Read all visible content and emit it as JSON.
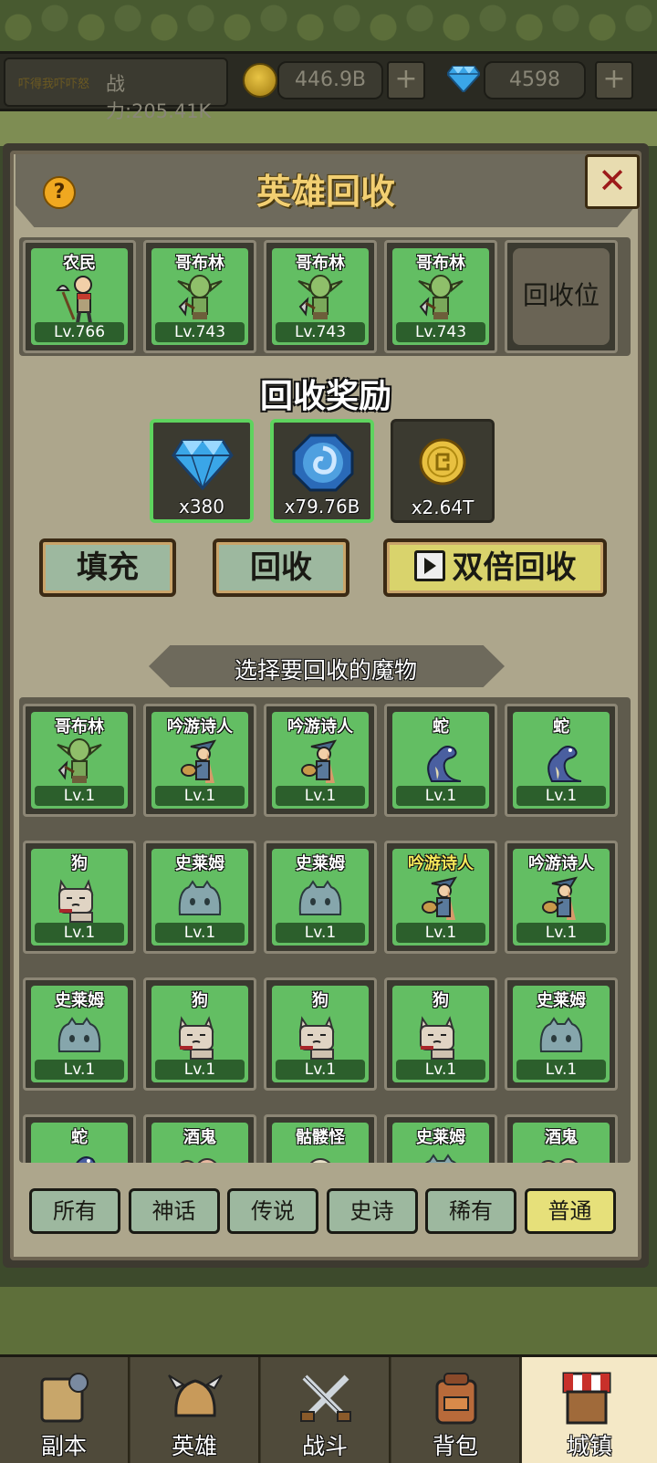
{
  "topbar": {
    "player_name": "吓得我吓吓怒",
    "power": "战力:205.41K",
    "gold": "446.9B",
    "gems": "4598",
    "plus": "+"
  },
  "panel": {
    "title": "英雄回收",
    "help": "?",
    "close": "✕"
  },
  "slots": [
    {
      "name": "农民",
      "level": "Lv.766",
      "monster": "peasant"
    },
    {
      "name": "哥布林",
      "level": "Lv.743",
      "monster": "goblin"
    },
    {
      "name": "哥布林",
      "level": "Lv.743",
      "monster": "goblin"
    },
    {
      "name": "哥布林",
      "level": "Lv.743",
      "monster": "goblin"
    }
  ],
  "empty_slot_label": "回收位",
  "rewards": {
    "title": "回收奖励",
    "items": [
      {
        "icon": "diamond-icon",
        "value": "x380",
        "highlight": true
      },
      {
        "icon": "blue-rune-icon",
        "value": "x79.76B",
        "highlight": true
      },
      {
        "icon": "gold-coin-icon",
        "value": "x2.64T",
        "highlight": false
      }
    ]
  },
  "actions": {
    "fill": "填充",
    "recycle": "回收",
    "double": "双倍回收"
  },
  "section_title": "选择要回收的魔物",
  "monsters": [
    {
      "name": "哥布林",
      "level": "Lv.1",
      "monster": "goblin"
    },
    {
      "name": "吟游诗人",
      "level": "Lv.1",
      "monster": "bard"
    },
    {
      "name": "吟游诗人",
      "level": "Lv.1",
      "monster": "bard"
    },
    {
      "name": "蛇",
      "level": "Lv.1",
      "monster": "snake"
    },
    {
      "name": "蛇",
      "level": "Lv.1",
      "monster": "snake"
    },
    {
      "name": "狗",
      "level": "Lv.1",
      "monster": "dog"
    },
    {
      "name": "史莱姆",
      "level": "Lv.1",
      "monster": "slime"
    },
    {
      "name": "史莱姆",
      "level": "Lv.1",
      "monster": "slime"
    },
    {
      "name": "吟游诗人",
      "level": "Lv.1",
      "monster": "bard",
      "yellow": true
    },
    {
      "name": "吟游诗人",
      "level": "Lv.1",
      "monster": "bard"
    },
    {
      "name": "史莱姆",
      "level": "Lv.1",
      "monster": "slime"
    },
    {
      "name": "狗",
      "level": "Lv.1",
      "monster": "dog"
    },
    {
      "name": "狗",
      "level": "Lv.1",
      "monster": "dog"
    },
    {
      "name": "狗",
      "level": "Lv.1",
      "monster": "dog"
    },
    {
      "name": "史莱姆",
      "level": "Lv.1",
      "monster": "slime"
    },
    {
      "name": "蛇",
      "level": "",
      "monster": "snake"
    },
    {
      "name": "酒鬼",
      "level": "",
      "monster": "drunk"
    },
    {
      "name": "骷髅怪",
      "level": "",
      "monster": "skeleton"
    },
    {
      "name": "史莱姆",
      "level": "",
      "monster": "slime"
    },
    {
      "name": "酒鬼",
      "level": "",
      "monster": "drunk"
    }
  ],
  "filters": [
    {
      "label": "所有",
      "active": false
    },
    {
      "label": "神话",
      "active": false
    },
    {
      "label": "传说",
      "active": false
    },
    {
      "label": "史诗",
      "active": false
    },
    {
      "label": "稀有",
      "active": false
    },
    {
      "label": "普通",
      "active": true
    }
  ],
  "nav": [
    {
      "label": "副本",
      "icon": "map-icon",
      "active": false
    },
    {
      "label": "英雄",
      "icon": "helmet-icon",
      "active": false
    },
    {
      "label": "战斗",
      "icon": "swords-icon",
      "active": false
    },
    {
      "label": "背包",
      "icon": "backpack-icon",
      "active": false
    },
    {
      "label": "城镇",
      "icon": "shop-icon",
      "active": true
    }
  ],
  "colors": {
    "card_green": "#63be63",
    "title_gold": "#f2cf72",
    "reward_highlight": "#5ed35e",
    "filter_active": "#e6e07a"
  }
}
